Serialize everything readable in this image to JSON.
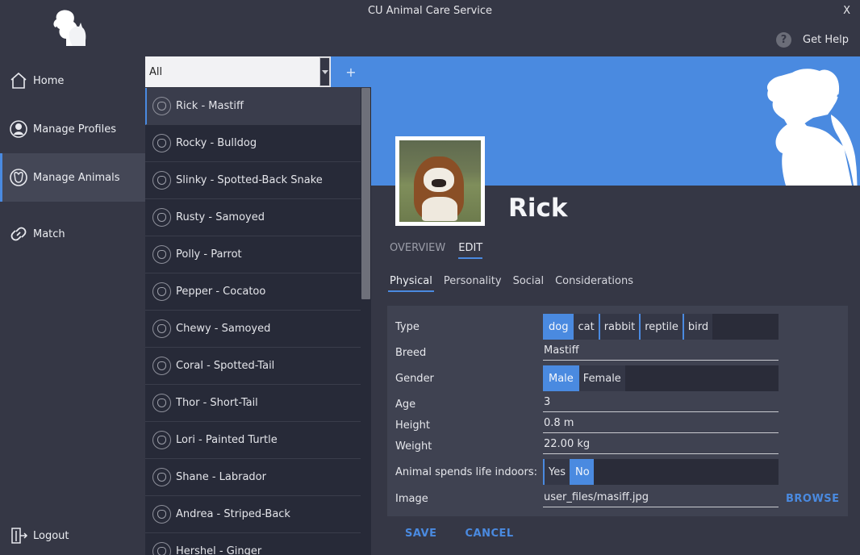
{
  "window": {
    "title": "CU Animal Care Service",
    "close_label": "X"
  },
  "help": {
    "icon": "?",
    "label": "Get Help"
  },
  "nav": {
    "items": [
      {
        "label": "Home",
        "icon": "home-icon"
      },
      {
        "label": "Manage Profiles",
        "icon": "profile-icon"
      },
      {
        "label": "Manage Animals",
        "icon": "animals-icon"
      },
      {
        "label": "Match",
        "icon": "match-icon"
      }
    ],
    "logout_label": "Logout"
  },
  "filter": {
    "value": "All",
    "add_label": "+"
  },
  "animals": [
    {
      "label": "Rick  -  Mastiff"
    },
    {
      "label": "Rocky  -  Bulldog"
    },
    {
      "label": "Slinky  -  Spotted-Back Snake"
    },
    {
      "label": "Rusty  -  Samoyed"
    },
    {
      "label": "Polly  -  Parrot"
    },
    {
      "label": "Pepper  -  Cocatoo"
    },
    {
      "label": "Chewy  -  Samoyed"
    },
    {
      "label": "Coral  -  Spotted-Tail"
    },
    {
      "label": "Thor  -  Short-Tail"
    },
    {
      "label": "Lori  -  Painted Turtle"
    },
    {
      "label": "Shane  -  Labrador"
    },
    {
      "label": "Andrea  -  Striped-Back"
    },
    {
      "label": "Hershel  -  Ginger"
    }
  ],
  "profile": {
    "name": "Rick",
    "tabs": [
      "OVERVIEW",
      "EDIT"
    ],
    "subtabs": [
      "Physical",
      "Personality",
      "Social",
      "Considerations"
    ]
  },
  "form": {
    "type_label": "Type",
    "type_options": [
      "dog",
      "cat",
      "rabbit",
      "reptile",
      "bird"
    ],
    "type_selected": "dog",
    "breed_label": "Breed",
    "breed_value": "Mastiff",
    "gender_label": "Gender",
    "gender_options": [
      "Male",
      "Female"
    ],
    "gender_selected": "Male",
    "age_label": "Age",
    "age_value": "3",
    "height_label": "Height",
    "height_value": "0.8 m",
    "weight_label": "Weight",
    "weight_value": "22.00 kg",
    "indoors_label": "Animal spends life indoors:",
    "indoors_options": [
      "Yes",
      "No"
    ],
    "indoors_selected": "No",
    "image_label": "Image",
    "image_value": "user_files/masiff.jpg",
    "browse_label": "BROWSE"
  },
  "actions": {
    "save": "SAVE",
    "cancel": "CANCEL"
  },
  "colors": {
    "accent": "#4a8ae0",
    "background": "#353745",
    "list_bg": "#272a38",
    "form_bg": "#3f4251"
  }
}
